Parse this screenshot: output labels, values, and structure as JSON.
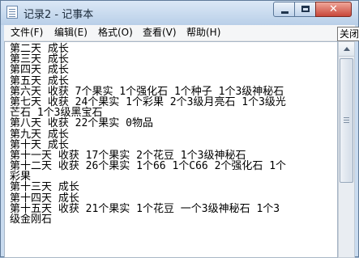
{
  "window": {
    "title": "记录2 - 记事本",
    "controls": {
      "minimize_icon": "minimize-icon",
      "maximize_icon": "maximize-icon",
      "close_glyph": "✕"
    }
  },
  "menu": {
    "items": [
      "文件(F)",
      "编辑(E)",
      "格式(O)",
      "查看(V)",
      "帮助(H)"
    ]
  },
  "tooltip": {
    "text": "关闭"
  },
  "editor": {
    "lines": [
      "第二天 成长",
      "第三天 成长",
      "第四天 成长",
      "第五天 成长",
      "第六天 收获 7个果实 1个强化石 1个种子 1个3级神秘石",
      "第七天 收获 24个果实 1个彩果 2个3级月亮石 1个3级光",
      "芒石 1个3级黑宝石",
      "第八天 收获 22个果实 0物品",
      "第九天 成长",
      "第十天 成长",
      "第十一天 收获 17个果实 2个花豆 1个3级神秘石",
      "第十二天 收获 26个果实 1个66 1个C66 2个强化石 1个",
      "彩果",
      "第十三天 成长",
      "第十四天 成长",
      "第十五天 收获 21个果实 1个花豆 一个3级神秘石 1个3",
      "级金刚石"
    ]
  },
  "colors": {
    "titlebar": "#c9dbef",
    "close_button": "#c8473a",
    "editor_bg": "#ffffff"
  }
}
